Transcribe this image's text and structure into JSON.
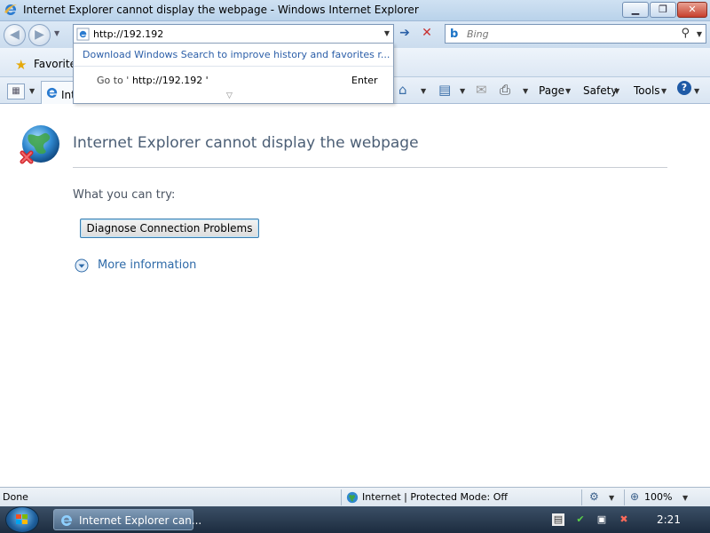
{
  "window": {
    "title": "Internet Explorer cannot display the webpage - Windows Internet Explorer",
    "minimize_glyph": "▁",
    "maximize_glyph": "❐",
    "close_glyph": "✕"
  },
  "nav": {
    "back_glyph": "◀",
    "forward_glyph": "▶",
    "recent_dropdown_glyph": "▼"
  },
  "address": {
    "value": "http://192.192",
    "dropdown_glyph": "▼",
    "go_glyph": "➔",
    "stop_glyph": "✕"
  },
  "search": {
    "placeholder": "Bing",
    "bing_glyph": "b",
    "search_glyph": "⚲",
    "dropdown_glyph": "▼"
  },
  "autocomplete": {
    "promo": "Download Windows Search to improve history and favorites r...",
    "goto_label": "Go to '",
    "goto_url": "http://192.192 '",
    "enter_label": "Enter",
    "more_glyph": "▽"
  },
  "favorites": {
    "label": "Favorite",
    "star_glyph": "★"
  },
  "command_bar": {
    "tab_label": "Int",
    "quicktabs_glyph": "▦",
    "dropdown_glyph": "▼",
    "home_glyph": "⌂",
    "feeds_glyph": "▤",
    "mail_glyph": "✉",
    "print_glyph": "⎙",
    "page_label": "Page",
    "safety_label": "Safety",
    "tools_label": "Tools",
    "help_glyph": "?"
  },
  "content": {
    "title": "Internet Explorer cannot display the webpage",
    "what_you_can_try": "What you can try:",
    "diagnose_button": "Diagnose Connection Problems",
    "more_information": "More information"
  },
  "status_bar": {
    "status": "Done",
    "zone": "Internet | Protected Mode: Off",
    "zoom": "100%",
    "zoom_glyph": "⊕",
    "dropdown_glyph": "▼",
    "security_glyph": "⚙"
  },
  "taskbar": {
    "task_label": "Internet Explorer can...",
    "clock": "2:21"
  },
  "colors": {
    "title_text": "#4b5e75",
    "link": "#2e6aa8",
    "ie_blue": "#1a73c6",
    "error_red": "#d2282e"
  }
}
